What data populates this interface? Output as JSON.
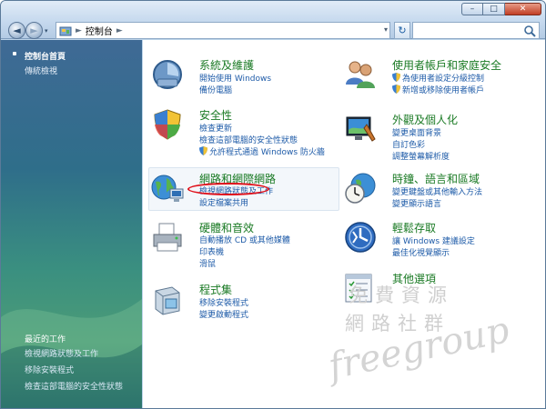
{
  "window": {
    "caption": {
      "minimize": "–",
      "maximize": "□",
      "close": "✕"
    }
  },
  "nav": {
    "back": "◄",
    "forward": "►",
    "dropdown": "▾"
  },
  "address": {
    "separator1": "►",
    "crumb": "控制台",
    "separator2": "►",
    "dropdown": "▾"
  },
  "refresh": {
    "label": "↻"
  },
  "search": {
    "value": "",
    "placeholder": ""
  },
  "sidebar": {
    "home": "控制台首頁",
    "classic": "傳統檢視",
    "recent_title": "最近的工作",
    "recent": [
      "檢視網路狀態及工作",
      "移除安裝程式",
      "檢查這部電腦的安全性狀態"
    ]
  },
  "categories": {
    "system": {
      "title": "系統及維護",
      "links": [
        "開始使用 Windows",
        "備份電腦"
      ],
      "icon": "system-maintenance-icon"
    },
    "security": {
      "title": "安全性",
      "links": [
        "檢查更新",
        "檢查這部電腦的安全性狀態",
        "允許程式通過 Windows 防火牆"
      ],
      "icon": "security-shield-icon"
    },
    "network": {
      "title": "網路和網際網路",
      "links": [
        "檢視網路狀態及工作",
        "設定檔案共用"
      ],
      "icon": "network-globe-icon"
    },
    "hardware": {
      "title": "硬體和音效",
      "links": [
        "自動播放 CD 或其他媒體",
        "印表機",
        "滑鼠"
      ],
      "icon": "printer-icon"
    },
    "programs": {
      "title": "程式集",
      "links": [
        "移除安裝程式",
        "變更啟動程式"
      ],
      "icon": "programs-icon"
    },
    "users": {
      "title": "使用者帳戶和家庭安全",
      "links": [
        "為使用者設定分級控制",
        "新增或移除使用者帳戶"
      ],
      "icon": "users-icon"
    },
    "appearance": {
      "title": "外觀及個人化",
      "links": [
        "變更桌面背景",
        "自訂色彩",
        "調整螢幕解析度"
      ],
      "icon": "appearance-icon"
    },
    "clock": {
      "title": "時鐘、語言和區域",
      "links": [
        "變更鍵盤或其他輸入方法",
        "變更顯示語言"
      ],
      "icon": "clock-globe-icon"
    },
    "access": {
      "title": "輕鬆存取",
      "links": [
        "讓 Windows 建議設定",
        "最佳化視覺顯示"
      ],
      "icon": "ease-of-access-icon"
    },
    "other": {
      "title": "其他選項",
      "links": [],
      "icon": "other-options-icon"
    }
  },
  "watermark": {
    "line1": "免費資源",
    "line2": "網路社群",
    "line3": "freegroup"
  },
  "colors": {
    "category_title": "#1a7a24",
    "link": "#1e5ba8",
    "highlight": "#e0101a"
  }
}
